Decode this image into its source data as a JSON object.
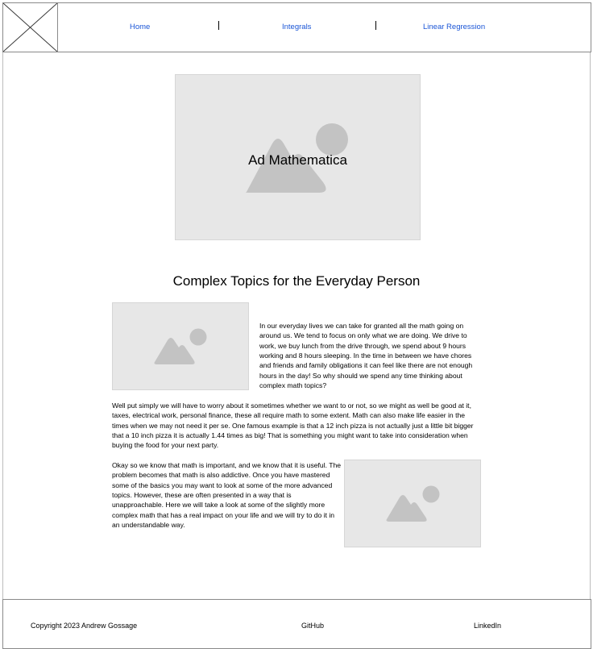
{
  "header": {
    "logo_icon": "image-placeholder-icon",
    "nav": [
      {
        "label": "Home"
      },
      {
        "label": "Integrals"
      },
      {
        "label": "Linear Regression"
      }
    ]
  },
  "hero": {
    "title": "Ad Mathematica",
    "image_icon": "image-placeholder-icon"
  },
  "main": {
    "section_title": "Complex Topics for the Everyday Person",
    "paragraphs": [
      "In our everyday lives we can take for granted all the math going on around us. We tend to focus on only what we are doing. We drive to work, we buy lunch from the drive through, we spend about 9 hours working and 8 hours sleeping. In the time in between we have chores and friends and family obligations it can feel like there are not enough hours in the day! So why should we spend any time thinking about complex math topics?",
      "Well put simply we will have to worry about it sometimes whether we want to or not, so we might as well be good at it, taxes, electrical work, personal finance, these all require math to some extent. Math can also make life easier in the times when we may not need it per se. One famous example is that a 12 inch pizza is not actually just a little bit bigger that a 10 inch pizza it is actually 1.44 times as big! That is something you might want to take into consideration when buying the food for your next party.",
      "Okay so we know that math is important, and we know that it is useful. The problem becomes that math is also addictive. Once you have mastered some of the basics you may want to look at some of the more advanced topics. However, these are often presented in a way that is unapproachable. Here we will take a look at some of the slightly more complex math that has a real impact on your life and we will try to do it in an understandable way."
    ]
  },
  "footer": {
    "copyright": "Copyright 2023 Andrew Gossage",
    "github": "GitHub",
    "linkedin": "LinkedIn"
  },
  "colors": {
    "link": "#1a55d6",
    "placeholder_bg": "#e7e7e7",
    "placeholder_icon": "#c3c3c3",
    "border": "#8a8a8a"
  }
}
